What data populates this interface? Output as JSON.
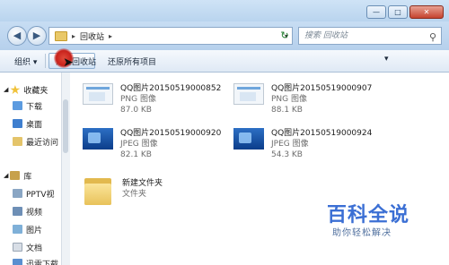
{
  "address": {
    "breadcrumb": "回收站",
    "search_placeholder": "搜索 回收站"
  },
  "toolbar": {
    "organize": "组织",
    "empty_recycle_bin": "清空回收站",
    "restore_all": "还原所有项目"
  },
  "sidebar": {
    "items": [
      {
        "label": "收藏夹"
      },
      {
        "label": "下载"
      },
      {
        "label": "桌面"
      },
      {
        "label": "最近访问"
      },
      {
        "label": "库"
      },
      {
        "label": "PPTV视"
      },
      {
        "label": "视频"
      },
      {
        "label": "图片"
      },
      {
        "label": "文档"
      },
      {
        "label": "迅雷下载"
      }
    ]
  },
  "files": [
    {
      "name": "QQ图片20150519000852",
      "type": "PNG 图像",
      "size": "87.0 KB",
      "kind": "png"
    },
    {
      "name": "QQ图片20150519000907",
      "type": "PNG 图像",
      "size": "88.1 KB",
      "kind": "png"
    },
    {
      "name": "QQ图片20150519000920",
      "type": "JPEG 图像",
      "size": "82.1 KB",
      "kind": "jpg"
    },
    {
      "name": "QQ图片20150519000924",
      "type": "JPEG 图像",
      "size": "54.3 KB",
      "kind": "jpg"
    },
    {
      "name": "新建文件夹",
      "type": "文件夹",
      "kind": "folder"
    }
  ],
  "watermark": {
    "brand": "百科全说",
    "tagline": "助你轻松解决"
  }
}
